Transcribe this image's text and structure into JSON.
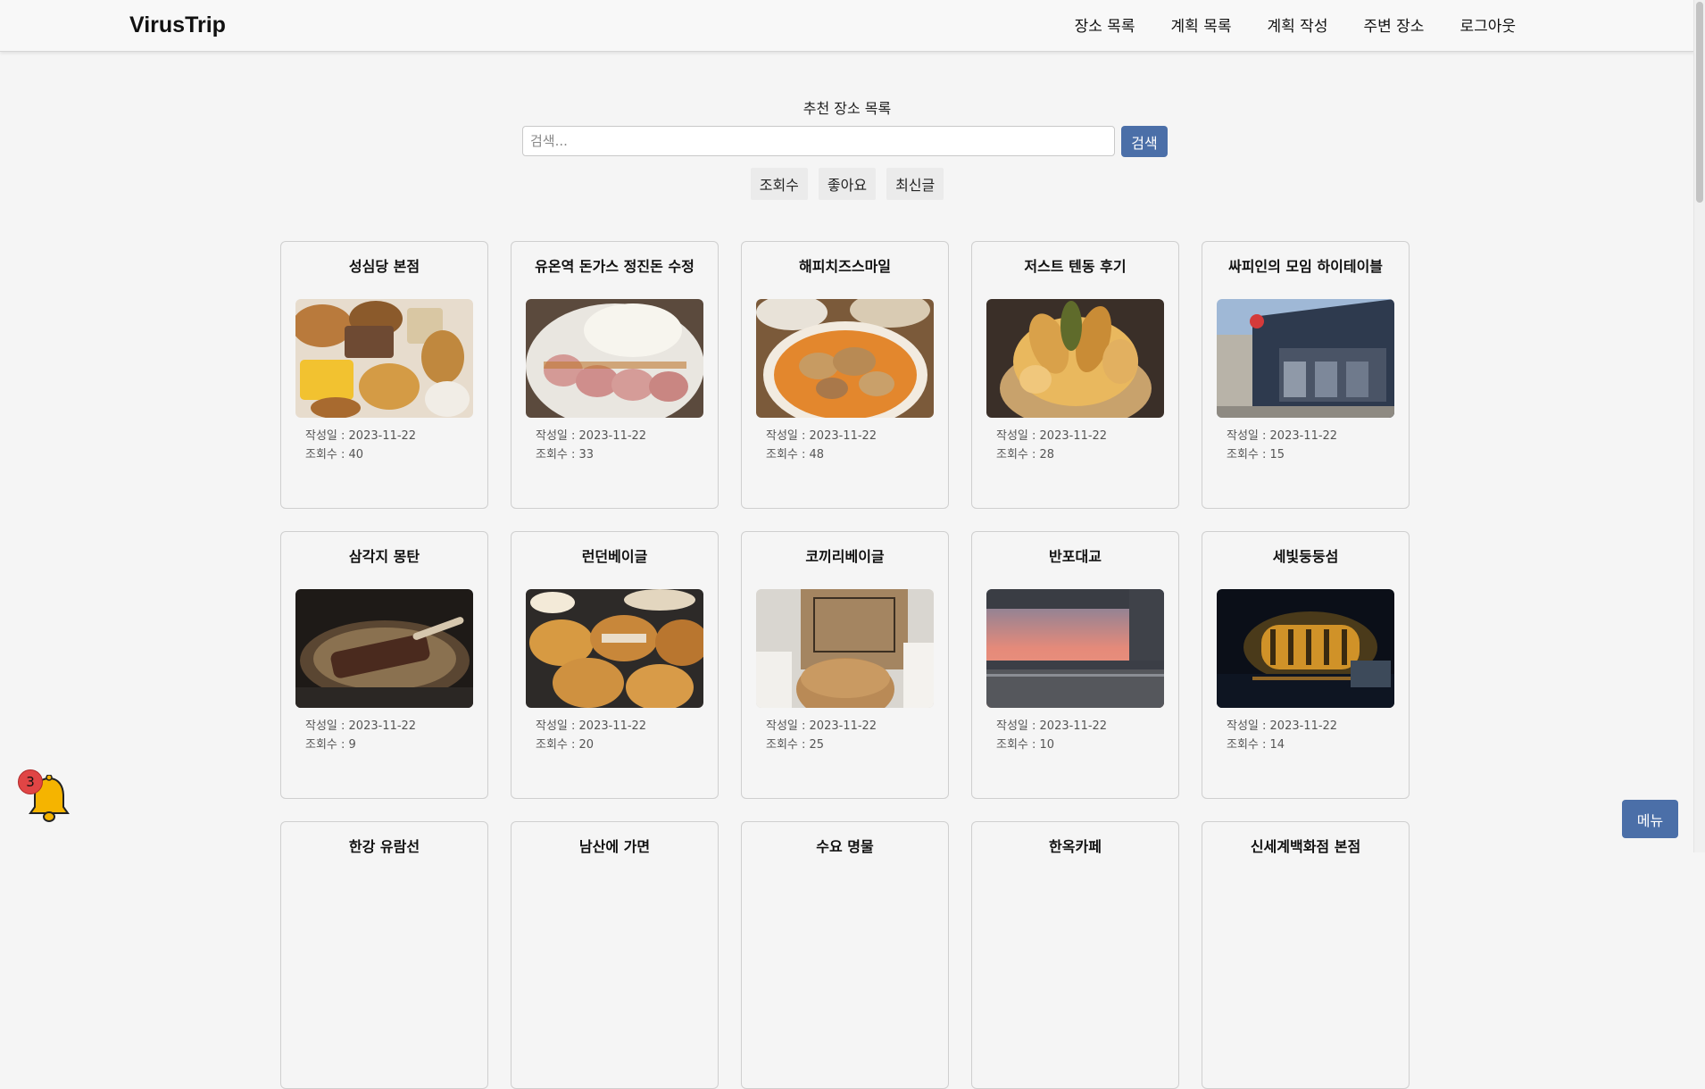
{
  "navbar": {
    "brand": "VirusTrip",
    "links": [
      "장소 목록",
      "계획 목록",
      "계획 작성",
      "주변 장소",
      "로그아웃"
    ]
  },
  "main": {
    "title": "추천 장소 목록",
    "search": {
      "placeholder": "검색...",
      "value": "",
      "button_label": "검색"
    },
    "sort_options": [
      "조회수",
      "좋아요",
      "최신글"
    ]
  },
  "cards": [
    {
      "title": "성심당 본점",
      "date_label": "작성일 : 2023-11-22",
      "views_label": "조회수 : 40",
      "image": "bread-pastries-photo"
    },
    {
      "title": "유온역 돈가스 정진돈 수정",
      "date_label": "작성일 : 2023-11-22",
      "views_label": "조회수 : 33",
      "image": "tonkatsu-photo"
    },
    {
      "title": "해피치즈스마일",
      "date_label": "작성일 : 2023-11-22",
      "views_label": "조회수 : 48",
      "image": "curry-dish-photo"
    },
    {
      "title": "저스트 텐동 후기",
      "date_label": "작성일 : 2023-11-22",
      "views_label": "조회수 : 28",
      "image": "tendon-photo"
    },
    {
      "title": "싸피인의 모임 하이테이블",
      "date_label": "작성일 : 2023-11-22",
      "views_label": "조회수 : 15",
      "image": "building-exterior-photo"
    },
    {
      "title": "삼각지 몽탄",
      "date_label": "작성일 : 2023-11-22",
      "views_label": "조회수 : 9",
      "image": "grilled-ribs-photo"
    },
    {
      "title": "런던베이글",
      "date_label": "작성일 : 2023-11-22",
      "views_label": "조회수 : 20",
      "image": "bagels-photo"
    },
    {
      "title": "코끼리베이글",
      "date_label": "작성일 : 2023-11-22",
      "views_label": "조회수 : 25",
      "image": "bagel-bag-photo"
    },
    {
      "title": "반포대교",
      "date_label": "작성일 : 2023-11-22",
      "views_label": "조회수 : 10",
      "image": "sunset-bridge-photo"
    },
    {
      "title": "세빛둥둥섬",
      "date_label": "작성일 : 2023-11-22",
      "views_label": "조회수 : 14",
      "image": "night-island-photo"
    },
    {
      "title": "한강 유람선",
      "date_label": "",
      "views_label": "",
      "image": ""
    },
    {
      "title": "남산에 가면",
      "date_label": "",
      "views_label": "",
      "image": ""
    },
    {
      "title": "수요 명물",
      "date_label": "",
      "views_label": "",
      "image": ""
    },
    {
      "title": "한옥카페",
      "date_label": "",
      "views_label": "",
      "image": ""
    },
    {
      "title": "신세계백화점 본점",
      "date_label": "",
      "views_label": "",
      "image": ""
    }
  ],
  "notification": {
    "icon": "bell-icon",
    "count": "3"
  },
  "menu_button": "메뉴",
  "colors": {
    "primary": "#4b6fa8",
    "badge": "#e04545",
    "bell": "#f5b400"
  }
}
